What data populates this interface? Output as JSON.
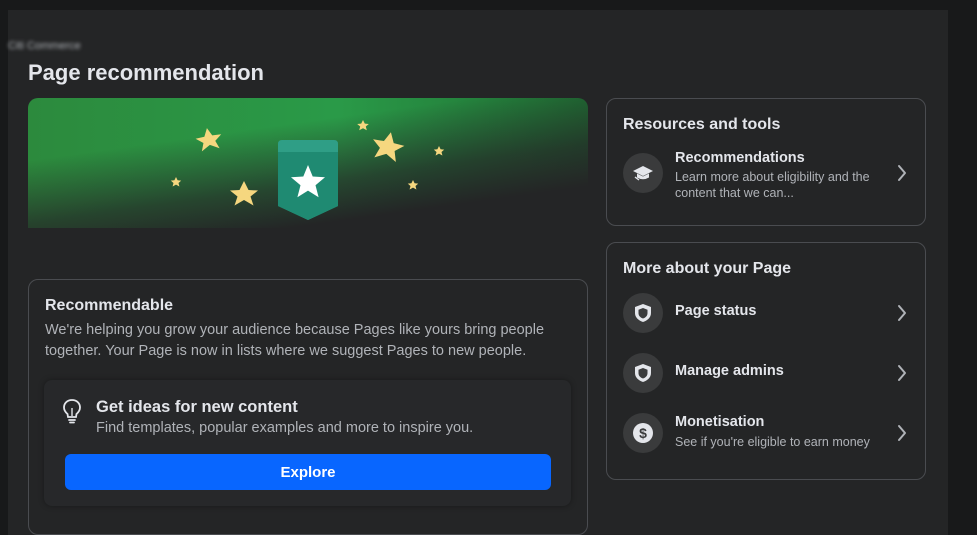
{
  "header": {
    "breadcrumb": "Citi Commerce",
    "title": "Page recommendation"
  },
  "status_card": {
    "heading": "Recommendable",
    "description": "We're helping you grow your audience because Pages like yours bring people together. Your Page is now in lists where we suggest Pages to new people."
  },
  "ideas": {
    "title": "Get ideas for new content",
    "description": "Find templates, popular examples and more to inspire you.",
    "button_label": "Explore",
    "icon": "lightbulb-icon"
  },
  "resources": {
    "title": "Resources and tools",
    "items": [
      {
        "label": "Recommendations",
        "subtitle": "Learn more about eligibility and the content that we can...",
        "icon": "graduation-cap-icon"
      }
    ]
  },
  "more_about": {
    "title": "More about your Page",
    "items": [
      {
        "label": "Page status",
        "subtitle": "",
        "icon": "shield-icon"
      },
      {
        "label": "Manage admins",
        "subtitle": "",
        "icon": "shield-icon"
      },
      {
        "label": "Monetisation",
        "subtitle": "See if you're eligible to earn money",
        "icon": "dollar-circle-icon"
      }
    ]
  },
  "colors": {
    "background": "#242526",
    "primary_button": "#0866ff",
    "hero_green": "#2a9a48",
    "star_yellow": "#f5d77f"
  }
}
